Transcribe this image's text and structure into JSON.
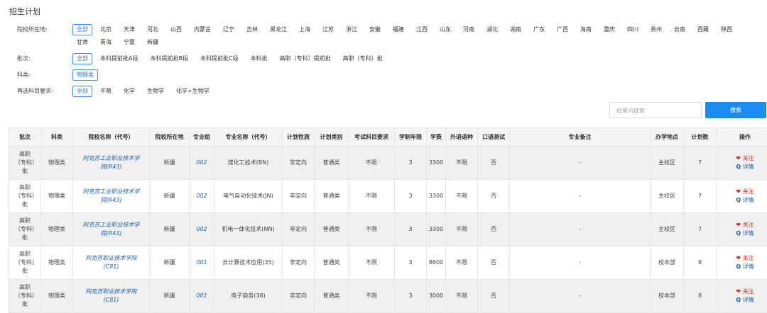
{
  "title": "招生计划",
  "filters": [
    {
      "label": "院校所在地:",
      "options": [
        "全部",
        "北京",
        "天津",
        "河北",
        "山西",
        "内蒙古",
        "辽宁",
        "吉林",
        "黑龙江",
        "上海",
        "江苏",
        "浙江",
        "安徽",
        "福建",
        "江西",
        "山东",
        "河南",
        "湖北",
        "湖南",
        "广东",
        "广西",
        "海南",
        "重庆",
        "四川",
        "贵州",
        "云南",
        "西藏",
        "陕西",
        "甘肃",
        "青海",
        "宁夏",
        "新疆"
      ],
      "selected": 0
    },
    {
      "label": "批次:",
      "options": [
        "全部",
        "本科提前批A段",
        "本科提前批B段",
        "本科提前批C段",
        "本科批",
        "高职（专科）提前批",
        "高职（专科）批"
      ],
      "selected": 0
    },
    {
      "label": "科类:",
      "options": [
        "物理类"
      ],
      "selected": 0
    },
    {
      "label": "再选科目要求:",
      "options": [
        "全部",
        "不限",
        "化学",
        "生物学",
        "化学+生物学"
      ],
      "selected": 0
    }
  ],
  "search": {
    "placeholder": "结果内搜索",
    "button": "搜索"
  },
  "table": {
    "headers": [
      "批次",
      "科类",
      "院校名称（代号）",
      "院校所在地",
      "专业组",
      "专业名称（代号）",
      "计划性质",
      "计划类别",
      "考试科目要求",
      "学制年限",
      "学费",
      "外语语种",
      "口语测试",
      "专业备注",
      "办学地点",
      "计划数",
      "操作"
    ],
    "rows": [
      [
        "高职（专科）批",
        "物理类",
        "阿克苏工业职业技术学院(R43)",
        "新疆",
        "002",
        "煤化工技术(BN)",
        "非定向",
        "普通类",
        "不限",
        "3",
        "3300",
        "不限",
        "否",
        "-",
        "主校区",
        "7"
      ],
      [
        "高职（专科）批",
        "物理类",
        "阿克苏工业职业技术学院(R43)",
        "新疆",
        "002",
        "电气自动化技术(JN)",
        "非定向",
        "普通类",
        "不限",
        "3",
        "3300",
        "不限",
        "否",
        "-",
        "主校区",
        "7"
      ],
      [
        "高职（专科）批",
        "物理类",
        "阿克苏工业职业技术学院(R43)",
        "新疆",
        "002",
        "机电一体化技术(NN)",
        "非定向",
        "普通类",
        "不限",
        "3",
        "3300",
        "不限",
        "否",
        "-",
        "主校区",
        "7"
      ],
      [
        "高职（专科）批",
        "物理类",
        "阿克苏职业技术学院(C81)",
        "新疆",
        "001",
        "云计算技术应用(35)",
        "非定向",
        "普通类",
        "不限",
        "3",
        "8600",
        "不限",
        "否",
        "-",
        "校本部",
        "8"
      ],
      [
        "高职（专科）批",
        "物理类",
        "阿克苏职业技术学院(C81)",
        "新疆",
        "001",
        "电子商务(38)",
        "非定向",
        "普通类",
        "不限",
        "3",
        "3000",
        "不限",
        "否",
        "-",
        "校本部",
        "8"
      ]
    ],
    "actions": {
      "follow": "关注",
      "detail": "详情"
    }
  }
}
